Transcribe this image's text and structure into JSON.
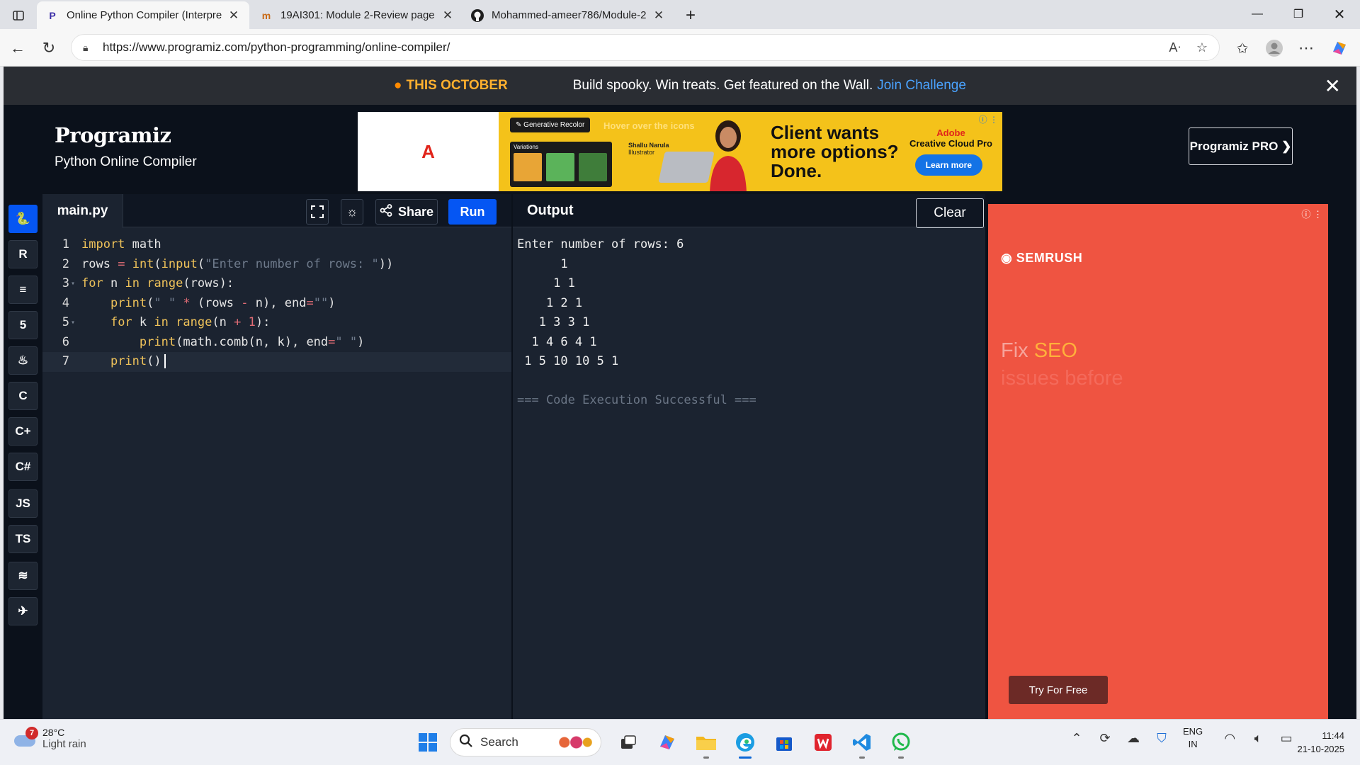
{
  "browser": {
    "tabs": [
      {
        "title": "Online Python Compiler (Interpre",
        "favicon": "P",
        "active": true
      },
      {
        "title": "19AI301: Module 2-Review page",
        "favicon": "m",
        "active": false
      },
      {
        "title": "Mohammed-ameer786/Module-2",
        "favicon": "github-icon",
        "active": false
      }
    ],
    "url": "https://www.programiz.com/python-programming/online-compiler/"
  },
  "promo": {
    "highlight": "THIS OCTOBER",
    "message": "Build spooky. Win treats. Get featured on the Wall.",
    "link": "Join Challenge"
  },
  "header": {
    "brand": "Programiz",
    "subtitle": "Python Online Compiler",
    "pro_button": "Programiz PRO ❯"
  },
  "banner_ad": {
    "tag": "Generative Recolor",
    "hint": "Hover over the icons",
    "variations_label": "Variations",
    "artist_name": "Shallu Narula",
    "artist_role": "Illustrator",
    "headline": [
      "Client wants",
      "more options?",
      "Done."
    ],
    "brand_line1": "Adobe",
    "brand_line2": "Creative Cloud Pro",
    "cta": "Learn more",
    "left_logo": "A"
  },
  "rail": {
    "items": [
      {
        "name": "python-icon",
        "label": "🐍"
      },
      {
        "name": "r-icon",
        "label": "R"
      },
      {
        "name": "sql-icon",
        "label": "≡"
      },
      {
        "name": "html-icon",
        "label": "5"
      },
      {
        "name": "java-icon",
        "label": "♨"
      },
      {
        "name": "c-icon",
        "label": "C"
      },
      {
        "name": "cpp-icon",
        "label": "C+"
      },
      {
        "name": "csharp-icon",
        "label": "C#"
      },
      {
        "name": "js-icon",
        "label": "JS"
      },
      {
        "name": "ts-icon",
        "label": "TS"
      },
      {
        "name": "go-icon",
        "label": "≋"
      },
      {
        "name": "swift-icon",
        "label": "✈"
      }
    ]
  },
  "editor": {
    "filename": "main.py",
    "share_label": "Share",
    "run_label": "Run",
    "lines": [
      "import math",
      "rows = int(input(\"Enter number of rows: \"))",
      "for n in range(rows):",
      "    print(\" \" * (rows - n), end=\"\")",
      "    for k in range(n + 1):",
      "        print(math.comb(n, k), end=\" \")",
      "    print()"
    ]
  },
  "output": {
    "title": "Output",
    "clear_label": "Clear",
    "lines": [
      "Enter number of rows: 6",
      "      1",
      "     1 1",
      "    1 2 1",
      "   1 3 3 1",
      "  1 4 6 4 1",
      " 1 5 10 10 5 1",
      "",
      "=== Code Execution Successful ==="
    ]
  },
  "side_ad": {
    "brand": "SEMRUSH",
    "headline_a": "Fix ",
    "headline_b": "SEO",
    "headline_c": "issues before",
    "cta": "Try For Free"
  },
  "taskbar": {
    "weather_badge": "7",
    "temperature": "28°C",
    "condition": "Light rain",
    "search_placeholder": "Search",
    "lang_line1": "ENG",
    "lang_line2": "IN",
    "time": "11:44",
    "date": "21-10-2025"
  },
  "colors": {
    "accent": "#0556f3",
    "page_bg": "#1b2330",
    "header_bg": "#0b111b",
    "semrush": "#ef5441"
  }
}
